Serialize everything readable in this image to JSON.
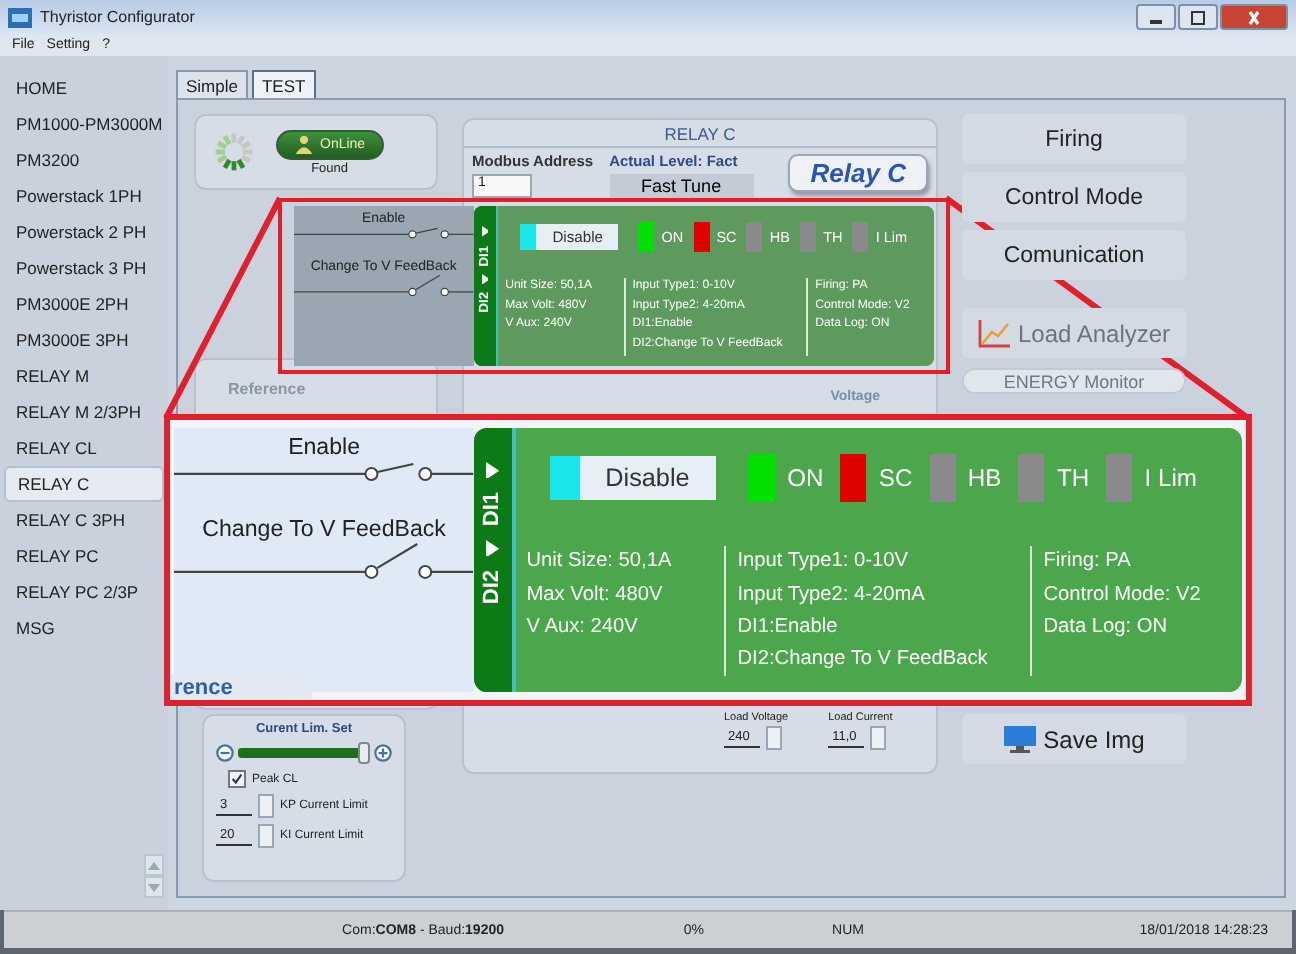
{
  "window": {
    "title": "Thyristor Configurator"
  },
  "menu": [
    "File",
    "Setting",
    "?"
  ],
  "sidebar": {
    "items": [
      {
        "label": "HOME",
        "selected": false
      },
      {
        "label": "PM1000-PM3000M",
        "selected": false
      },
      {
        "label": "PM3200",
        "selected": false
      },
      {
        "label": "Powerstack 1PH",
        "selected": false
      },
      {
        "label": "Powerstack 2 PH",
        "selected": false
      },
      {
        "label": "Powerstack 3 PH",
        "selected": false
      },
      {
        "label": "PM3000E  2PH",
        "selected": false
      },
      {
        "label": "PM3000E  3PH",
        "selected": false
      },
      {
        "label": "RELAY M",
        "selected": false
      },
      {
        "label": "RELAY M 2/3PH",
        "selected": false
      },
      {
        "label": "RELAY CL",
        "selected": false
      },
      {
        "label": "RELAY C",
        "selected": true
      },
      {
        "label": "RELAY C 3PH",
        "selected": false
      },
      {
        "label": "RELAY PC",
        "selected": false
      },
      {
        "label": "RELAY PC 2/3P",
        "selected": false
      },
      {
        "label": "MSG",
        "selected": false
      }
    ]
  },
  "tabs": [
    {
      "label": "Simple",
      "selected": false
    },
    {
      "label": "TEST",
      "selected": true
    }
  ],
  "connection": {
    "button": "OnLine",
    "status": "Found"
  },
  "reference": {
    "title": "Reference"
  },
  "current_limit": {
    "title": "Curent Lim. Set",
    "level": 0.95,
    "peak": {
      "label": "Peak CL",
      "checked": true
    },
    "spins": [
      {
        "value": "3",
        "label": "KP Current Limit"
      },
      {
        "value": "20",
        "label": "KI Current Limit"
      }
    ]
  },
  "relay": {
    "title": "RELAY C",
    "modbus_label": "Modbus Address",
    "modbus_value": "1",
    "level_text": "Actual Level: Fact",
    "tune_button": "Fast Tune",
    "logo": "Relay C",
    "voltage_label": "Voltage",
    "load": [
      {
        "label": "Load Voltage",
        "value": "240"
      },
      {
        "label": "Load Current",
        "value": "11,0"
      }
    ]
  },
  "actions": [
    {
      "label": "Firing",
      "kind": "text"
    },
    {
      "label": "Control Mode",
      "kind": "text"
    },
    {
      "label": "Comunication",
      "kind": "text"
    },
    {
      "label": "Load Analyzer",
      "kind": "chart"
    },
    {
      "label": "ENERGY Monitor",
      "kind": "slim"
    },
    {
      "label": "Save Img",
      "kind": "monitor"
    }
  ],
  "status_panel": {
    "inputs": [
      {
        "label": "Enable",
        "closed": true
      },
      {
        "label": "Change To V FeedBack",
        "closed": false
      }
    ],
    "strip": [
      "DI1",
      "DI2"
    ],
    "disable_button": "Disable",
    "indicators": [
      {
        "label": "ON",
        "color": "#00e000"
      },
      {
        "label": "SC",
        "color": "#e00000"
      },
      {
        "label": "HB",
        "color": "#8a8a8a"
      },
      {
        "label": "TH",
        "color": "#8a8a8a"
      },
      {
        "label": "I Lim",
        "color": "#8a8a8a"
      }
    ],
    "columns": [
      {
        "lines": [
          "Unit Size: 50,1A",
          "Max Volt: 480V",
          "V Aux: 240V"
        ]
      },
      {
        "lines": [
          "Input Type1: 0-10V",
          "Input Type2: 4-20mA",
          "DI1:Enable",
          "DI2:Change To V FeedBack"
        ]
      },
      {
        "lines": [
          "Firing: PA",
          "Control Mode: V2",
          "Data Log:  ON"
        ]
      }
    ]
  },
  "callout": {
    "reference_title": "rence",
    "status_panel": {
      "inputs": [
        {
          "label": "Enable",
          "closed": true
        },
        {
          "label": "Change To V FeedBack",
          "closed": false
        }
      ],
      "strip": [
        "DI1",
        "DI2"
      ],
      "disable_button": "Disable",
      "indicators": [
        {
          "label": "ON",
          "color": "#00e000"
        },
        {
          "label": "SC",
          "color": "#e00000"
        },
        {
          "label": "HB",
          "color": "#8a8a8a"
        },
        {
          "label": "TH",
          "color": "#8a8a8a"
        },
        {
          "label": "I Lim",
          "color": "#8a8a8a"
        }
      ],
      "columns": [
        {
          "lines": [
            "Unit Size: 50,1A",
            "Max Volt: 480V",
            "V Aux: 240V"
          ]
        },
        {
          "lines": [
            "Input Type1: 0-10V",
            "Input Type2: 4-20mA",
            "DI1:Enable",
            "DI2:Change To V FeedBack"
          ]
        },
        {
          "lines": [
            "Firing: PA",
            "Control Mode: V2",
            "Data Log:  ON"
          ]
        }
      ]
    }
  },
  "status_bar": {
    "connection": "Com:**COM8** - Baud:**19200**",
    "progress": "0%",
    "keys": "NUM",
    "datetime": "18/01/2018 14:28:23"
  }
}
